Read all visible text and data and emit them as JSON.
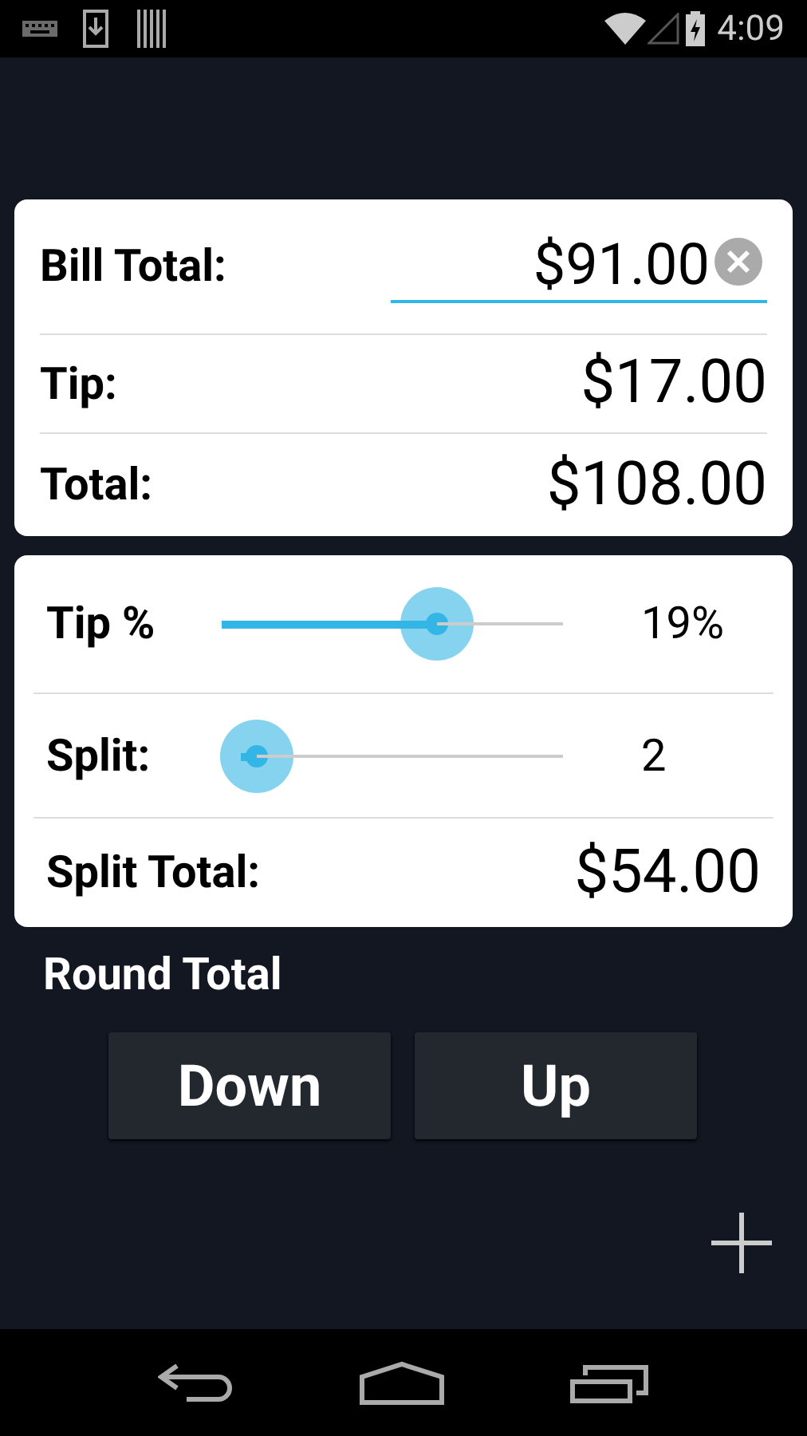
{
  "status_bar": {
    "time": "4:09"
  },
  "bill": {
    "label": "Bill Total:",
    "value": "$91.00"
  },
  "results": [
    {
      "label": "Tip:",
      "value": "$17.00"
    },
    {
      "label": "Total:",
      "value": "$108.00"
    }
  ],
  "sliders": [
    {
      "label": "Tip %",
      "level": 0.63,
      "reading": "19%"
    },
    {
      "label": "Split:",
      "level": 0.05,
      "reading": "2"
    }
  ],
  "split_total": {
    "label": "Split Total:",
    "value": "$54.00"
  },
  "round": {
    "label": "Round Total",
    "buttons": [
      "Down",
      "Up"
    ]
  }
}
